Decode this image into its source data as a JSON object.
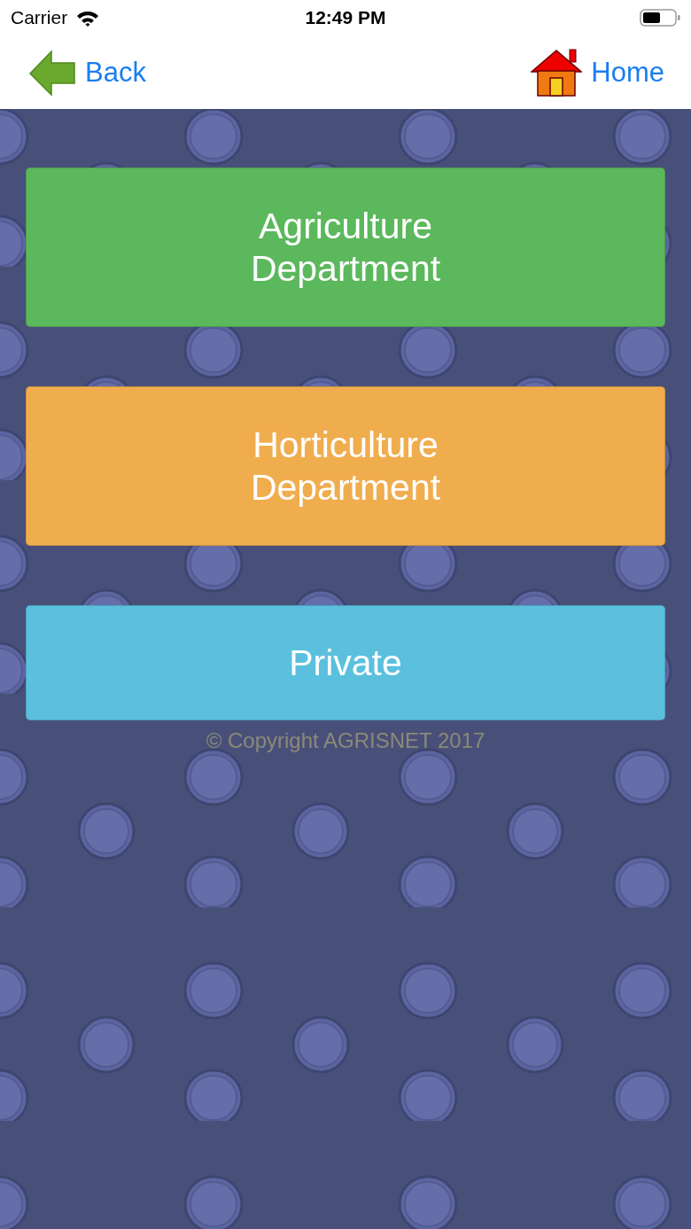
{
  "status_bar": {
    "carrier": "Carrier",
    "time": "12:49 PM"
  },
  "nav_bar": {
    "back": "Back",
    "home": "Home"
  },
  "menu": [
    {
      "label": "Agriculture\nDepartment",
      "color": "#5cb85c"
    },
    {
      "label": "Horticulture\nDepartment",
      "color": "#f0ad4e"
    },
    {
      "label": "Private",
      "color": "#5bc0de"
    }
  ],
  "footer": "© Copyright AGRISNET 2017"
}
